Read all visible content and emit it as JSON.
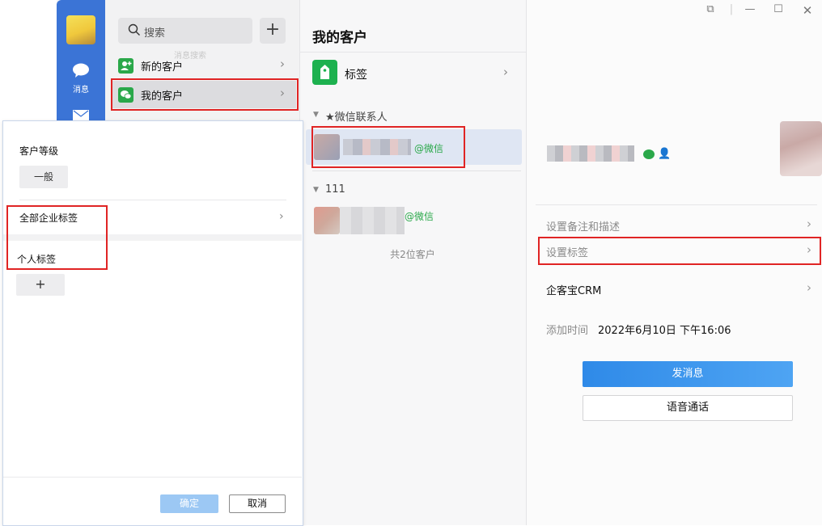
{
  "rail": {
    "msg_label": "消息"
  },
  "list": {
    "search_placeholder": "搜索",
    "add_symbol": "+",
    "ghost_text": "消息搜索",
    "nav": [
      {
        "label": "新的客户"
      },
      {
        "label": "我的客户"
      }
    ]
  },
  "middle": {
    "title": "我的客户",
    "tag_row_label": "标签",
    "group1": "★微信联系人",
    "contact1_suffix": "@微信",
    "group2": "111",
    "contact2_suffix": "@微信",
    "total": "共2位客户"
  },
  "detail": {
    "rows": [
      {
        "label": "设置备注和描述",
        "color": "#8a8a8a"
      },
      {
        "label": "设置标签",
        "color": "#8a8a8a"
      },
      {
        "label": "企客宝CRM",
        "color": "#111111"
      }
    ],
    "added_label": "添加时间",
    "added_value": "2022年6月10日 下午16:06",
    "send_button": "发消息",
    "call_button": "语音通话"
  },
  "popup": {
    "level_title": "客户等级",
    "level_value": "一般",
    "corp_tags_label": "全部企业标签",
    "personal_title": "个人标签",
    "add_tag_symbol": "+",
    "ok_button": "确定",
    "cancel_button": "取消"
  },
  "colors": {
    "accent": "#3b74d6",
    "wechat_green": "#2aa84a",
    "annotation_red": "#e02424"
  }
}
